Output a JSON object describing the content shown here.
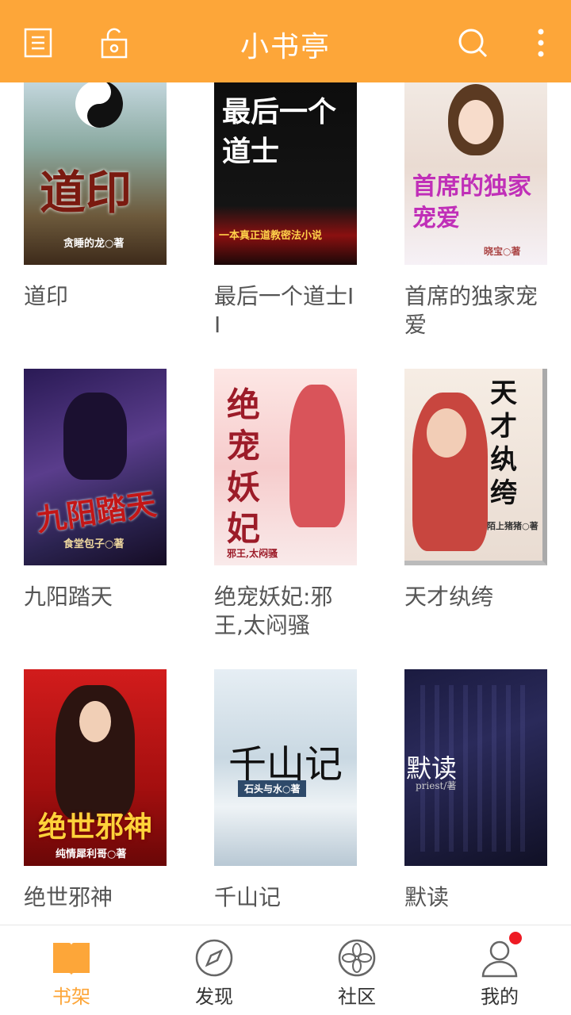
{
  "header": {
    "title": "小书亭",
    "icons": [
      "list-icon",
      "unlock-icon",
      "search-icon",
      "more-vertical-icon"
    ]
  },
  "books": [
    {
      "title": "道印",
      "cover_text": "道印",
      "cover_author": "贪睡的龙○著"
    },
    {
      "title": "最后一个道士II",
      "cover_text": "最后一个道士",
      "cover_author": "一本真正道教密法小说"
    },
    {
      "title": "首席的独家宠爱",
      "cover_text": "首席的独家宠爱",
      "cover_author": "晓宝○著"
    },
    {
      "title": "九阳踏天",
      "cover_text": "九阳踏天",
      "cover_author": "食堂包子○著"
    },
    {
      "title": "绝宠妖妃:邪王,太闷骚",
      "cover_text": "绝宠妖妃",
      "cover_author": "邪王,太闷骚"
    },
    {
      "title": "天才纨绔",
      "cover_text": "天才纨绔",
      "cover_author": "陌上猪猪○著"
    },
    {
      "title": "绝世邪神",
      "cover_text": "绝世邪神",
      "cover_author": "纯情犀利哥○著"
    },
    {
      "title": "千山记",
      "cover_text": "千山记",
      "cover_author": "石头与水○著"
    },
    {
      "title": "默读",
      "cover_text": "默读",
      "cover_author": "priest/著"
    }
  ],
  "tabs": [
    {
      "label": "书架",
      "icon": "book-icon",
      "active": true
    },
    {
      "label": "发现",
      "icon": "compass-icon",
      "active": false
    },
    {
      "label": "社区",
      "icon": "flower-icon",
      "active": false
    },
    {
      "label": "我的",
      "icon": "user-icon",
      "active": false,
      "badge": true
    }
  ],
  "colors": {
    "accent": "#fda639",
    "badge": "#ee1b24",
    "text": "#555555"
  }
}
